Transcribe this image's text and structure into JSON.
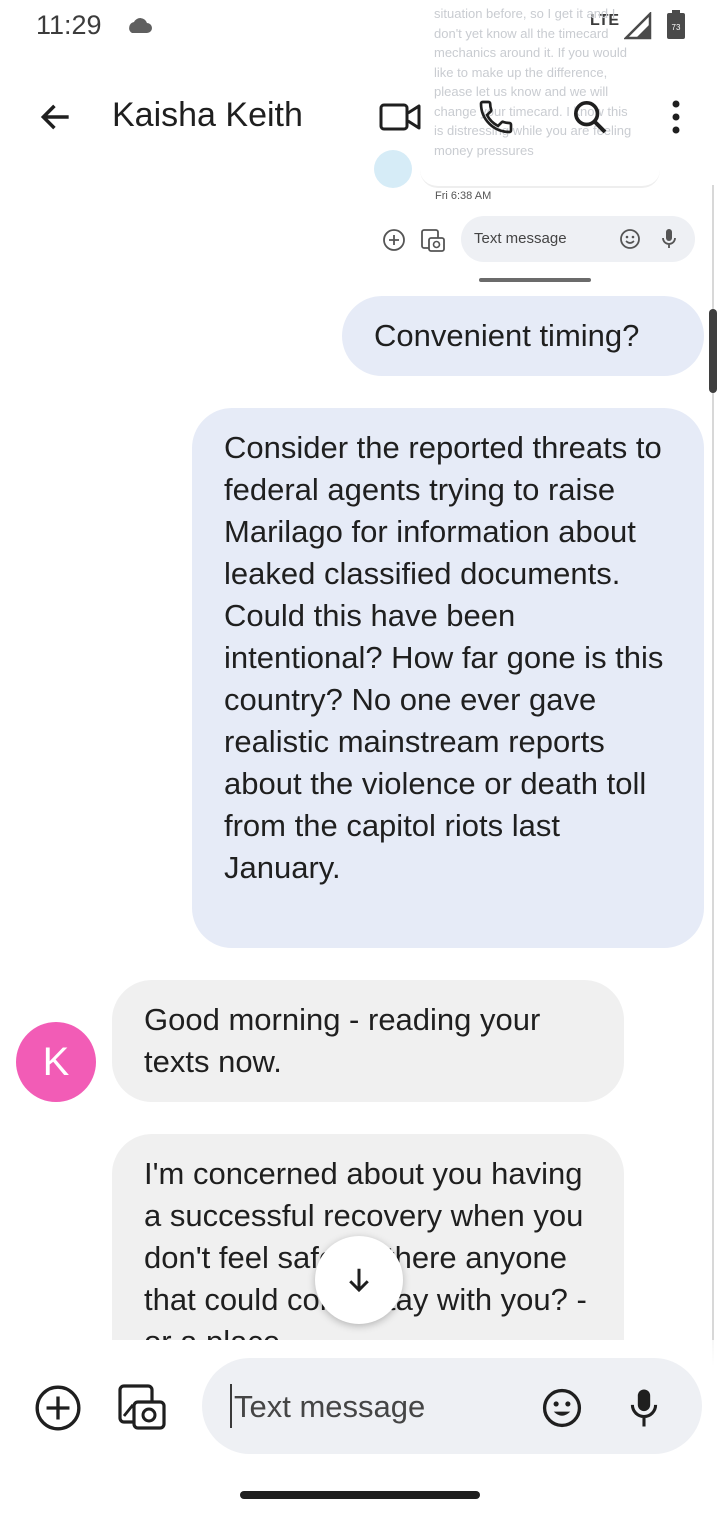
{
  "status_bar": {
    "time": "11:29",
    "network": "LTE",
    "battery_level": "73",
    "icons": [
      "cloud-icon",
      "signal-icon",
      "battery-icon"
    ]
  },
  "app_bar": {
    "contact_name": "Kaisha Keith",
    "icons": [
      "back-arrow-icon",
      "video-call-icon",
      "phone-icon",
      "search-icon",
      "more-vert-icon"
    ]
  },
  "embedded_screenshot": {
    "ghost_text": "situation before, so I get it and I don't yet know all the timecard mechanics around it. If you would like to make up the difference, please let us know and we will change your timecard. I know this is distressing while you are feeling money pressures",
    "timestamp": "Fri 6:38 AM",
    "input_placeholder": "Text message"
  },
  "messages": [
    {
      "direction": "outgoing",
      "text": "Convenient timing?"
    },
    {
      "direction": "outgoing",
      "text": "Consider the reported threats to federal agents trying to raise Marilago for information about leaked classified documents. Could this have been intentional? How far gone is this country? No one ever gave realistic mainstream reports about the violence or death toll from the capitol riots last January."
    },
    {
      "direction": "incoming",
      "sender_initial": "K",
      "text": "Good morning - reading your texts now."
    },
    {
      "direction": "incoming",
      "text": "I'm concerned about you having a successful recovery when you don't feel safe. Is there anyone that could come stay with you? - or a place"
    }
  ],
  "compose": {
    "placeholder": "Text message"
  },
  "colors": {
    "outgoing_bubble": "#e6ebf7",
    "incoming_bubble": "#f0f0f0",
    "avatar": "#f25cb6",
    "input_background": "#eef0f4"
  }
}
